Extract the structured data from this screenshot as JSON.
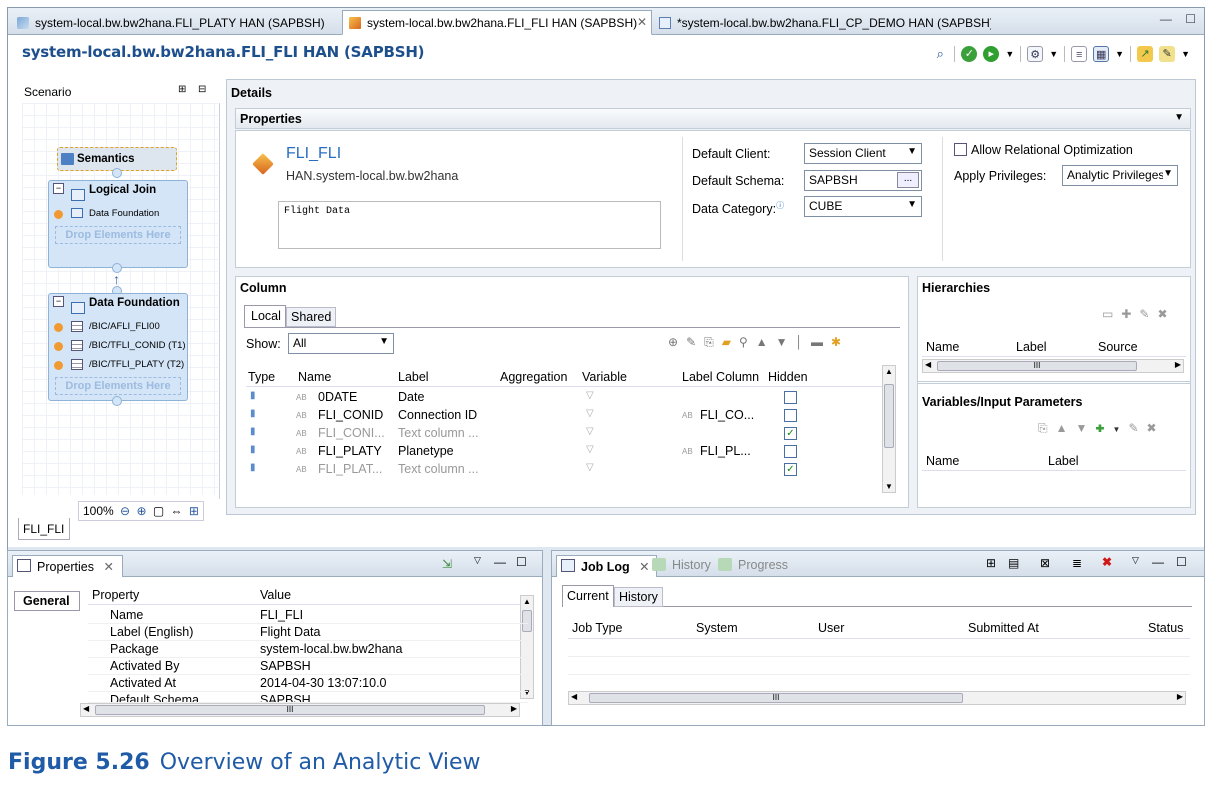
{
  "editor_tabs": [
    {
      "label": "system-local.bw.bw2hana.FLI_PLATY HAN (SAPBSH)"
    },
    {
      "label": "system-local.bw.bw2hana.FLI_FLI HAN (SAPBSH)"
    },
    {
      "label": "*system-local.bw.bw2hana.FLI_CP_DEMO HAN (SAPBSH)"
    }
  ],
  "editor": {
    "title": "system-local.bw.bw2hana.FLI_FLI HAN (SAPBSH)",
    "scenario_label": "Scenario",
    "zoom": "100%",
    "bottom_tab": "FLI_FLI"
  },
  "scenario": {
    "semantics": "Semantics",
    "logical_join": {
      "title": "Logical Join",
      "items": [
        "Data Foundation"
      ],
      "drop": "Drop Elements Here"
    },
    "data_foundation": {
      "title": "Data Foundation",
      "items": [
        "/BIC/AFLI_FLI00",
        "/BIC/TFLI_CONID (T1)",
        "/BIC/TFLI_PLATY (T2)"
      ],
      "drop": "Drop Elements Here"
    }
  },
  "details": {
    "title": "Details",
    "properties_title": "Properties",
    "name": "FLI_FLI",
    "package": "HAN.system-local.bw.bw2hana",
    "description": "Flight Data",
    "default_client_label": "Default Client:",
    "default_client_value": "Session Client",
    "default_schema_label": "Default Schema:",
    "default_schema_value": "SAPBSH",
    "browse_label": "...",
    "data_category_label": "Data Category:",
    "data_category_value": "CUBE",
    "allow_relational": "Allow Relational Optimization",
    "apply_privileges_label": "Apply Privileges:",
    "apply_privileges_value": "Analytic Privileges"
  },
  "column": {
    "title": "Column",
    "tabs": [
      "Local",
      "Shared"
    ],
    "show_label": "Show:",
    "show_value": "All",
    "headers": [
      "Type",
      "Name",
      "Label",
      "Aggregation",
      "Variable",
      "Label Column",
      "Hidden"
    ],
    "rows": [
      {
        "name": "0DATE",
        "label": "Date",
        "label_column": "",
        "hidden": false
      },
      {
        "name": "FLI_CONID",
        "label": "Connection ID",
        "label_column": "FLI_CO...",
        "hidden": false
      },
      {
        "name": "FLI_CONI...",
        "label": "Text column ...",
        "label_column": "",
        "hidden": true
      },
      {
        "name": "FLI_PLATY",
        "label": "Planetype",
        "label_column": "FLI_PL...",
        "hidden": false
      },
      {
        "name": "FLI_PLAT...",
        "label": "Text column ...",
        "label_column": "",
        "hidden": true
      }
    ]
  },
  "hierarchies": {
    "title": "Hierarchies",
    "headers": [
      "Name",
      "Label",
      "Source"
    ],
    "scroll_label": "III"
  },
  "variables": {
    "title": "Variables/Input Parameters",
    "headers": [
      "Name",
      "Label"
    ]
  },
  "properties_panel": {
    "tab": "Properties",
    "side_tab": "General",
    "headers": [
      "Property",
      "Value"
    ],
    "rows": [
      {
        "property": "Name",
        "value": "FLI_FLI"
      },
      {
        "property": "Label (English)",
        "value": "Flight Data"
      },
      {
        "property": "Package",
        "value": "system-local.bw.bw2hana"
      },
      {
        "property": "Activated By",
        "value": "SAPBSH"
      },
      {
        "property": "Activated At",
        "value": "2014-04-30 13:07:10.0"
      },
      {
        "property": "Default Schema",
        "value": "SAPBSH"
      }
    ],
    "scroll_label": "III"
  },
  "job_panel": {
    "tabs": [
      "Job Log",
      "History",
      "Progress"
    ],
    "sub_tabs": [
      "Current",
      "History"
    ],
    "headers": [
      "Job Type",
      "System",
      "User",
      "Submitted At",
      "Status"
    ],
    "scroll_label": "III"
  },
  "caption": {
    "label": "Figure 5.26",
    "text": "Overview of an Analytic View"
  },
  "colors": {
    "title_blue": "#1c4f8c",
    "caption_blue": "#1f5ba6",
    "node_fill": "#d3e5f7",
    "orange_dot": "#f19a32"
  }
}
